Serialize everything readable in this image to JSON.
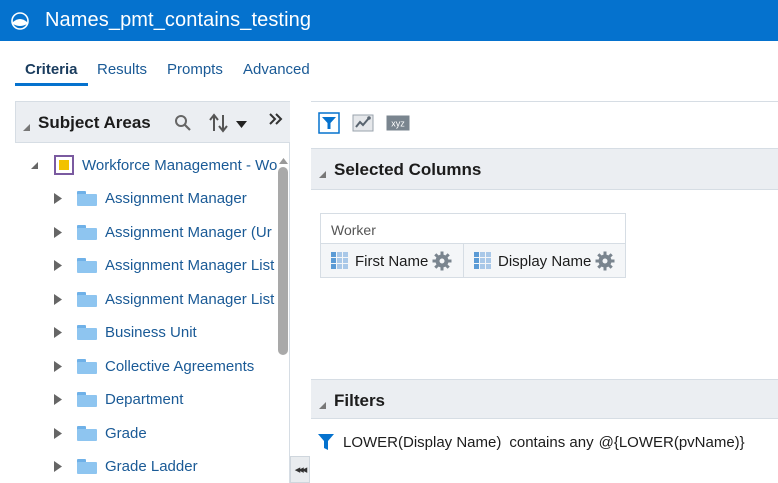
{
  "header": {
    "title": "Names_pmt_contains_testing",
    "logo_icon": "analytics-logo-icon"
  },
  "tabs": [
    {
      "label": "Criteria",
      "active": true
    },
    {
      "label": "Results",
      "active": false
    },
    {
      "label": "Prompts",
      "active": false
    },
    {
      "label": "Advanced",
      "active": false
    }
  ],
  "subject_areas": {
    "title": "Subject Areas",
    "search_icon": "search-icon",
    "sort_icon": "sort-icon",
    "more_icon": "double-chevron-right-icon",
    "root": {
      "label": "Workforce Management - Wo",
      "expanded": true
    },
    "items": [
      {
        "label": "Assignment Manager"
      },
      {
        "label": "Assignment Manager (Ur"
      },
      {
        "label": "Assignment Manager List"
      },
      {
        "label": "Assignment Manager List"
      },
      {
        "label": "Business Unit"
      },
      {
        "label": "Collective Agreements"
      },
      {
        "label": "Department"
      },
      {
        "label": "Grade"
      },
      {
        "label": "Grade Ladder"
      }
    ]
  },
  "toolbar": {
    "filter_icon": "filter-icon",
    "chart_icon": "chart-icon",
    "xyz_label": "xyz"
  },
  "selected_columns": {
    "title": "Selected Columns",
    "folder": "Worker",
    "columns": [
      {
        "label": "First Name"
      },
      {
        "label": "Display Name"
      }
    ]
  },
  "filters": {
    "title": "Filters",
    "items": [
      {
        "column": "LOWER(Display Name)",
        "operator": "contains any",
        "value": "@{LOWER(pvName)}"
      }
    ]
  },
  "colors": {
    "brand": "#0572ce",
    "link": "#1a5a96",
    "panel_header": "#ebeef2"
  }
}
